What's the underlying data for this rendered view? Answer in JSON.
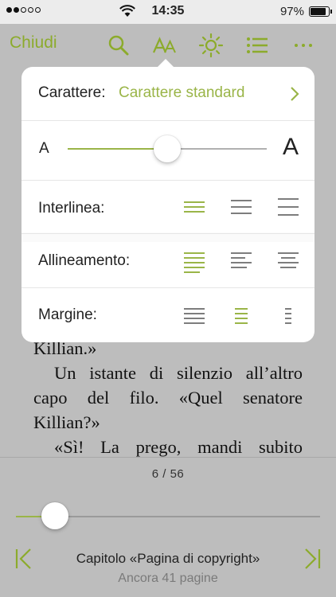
{
  "status_bar": {
    "time": "14:35",
    "battery_percent": "97%",
    "signal_bars_filled": 2,
    "signal_bars_total": 5,
    "battery_level": 0.97
  },
  "toolbar": {
    "close_label": "Chiudi",
    "icons": [
      "search-icon",
      "font-size-icon",
      "brightness-icon",
      "contents-list-icon",
      "more-icon"
    ],
    "accent": "#8cab2c"
  },
  "settings": {
    "font_label": "Carattere:",
    "font_value": "Carattere standard",
    "size_small": "A",
    "size_large": "A",
    "font_size_level": 0.5,
    "line_spacing_label": "Interlinea:",
    "line_spacing_selected": 0,
    "alignment_label": "Allineamento:",
    "alignment_selected": 0,
    "margin_label": "Margine:",
    "margin_selected": 1
  },
  "book": {
    "lines": [
      [
        "Killian.»"
      ],
      [
        "Un istante di silenzio all’altro"
      ],
      [
        "capo del filo. «Quel senatore"
      ],
      [
        "Killian?»"
      ],
      [
        "«Sì! La prego, mandi subito"
      ]
    ]
  },
  "footer": {
    "page_indicator": "6 / 56",
    "progress": 0.09,
    "chapter": "Capitolo «Pagina di copyright»",
    "remaining": "Ancora 41 pagine"
  }
}
